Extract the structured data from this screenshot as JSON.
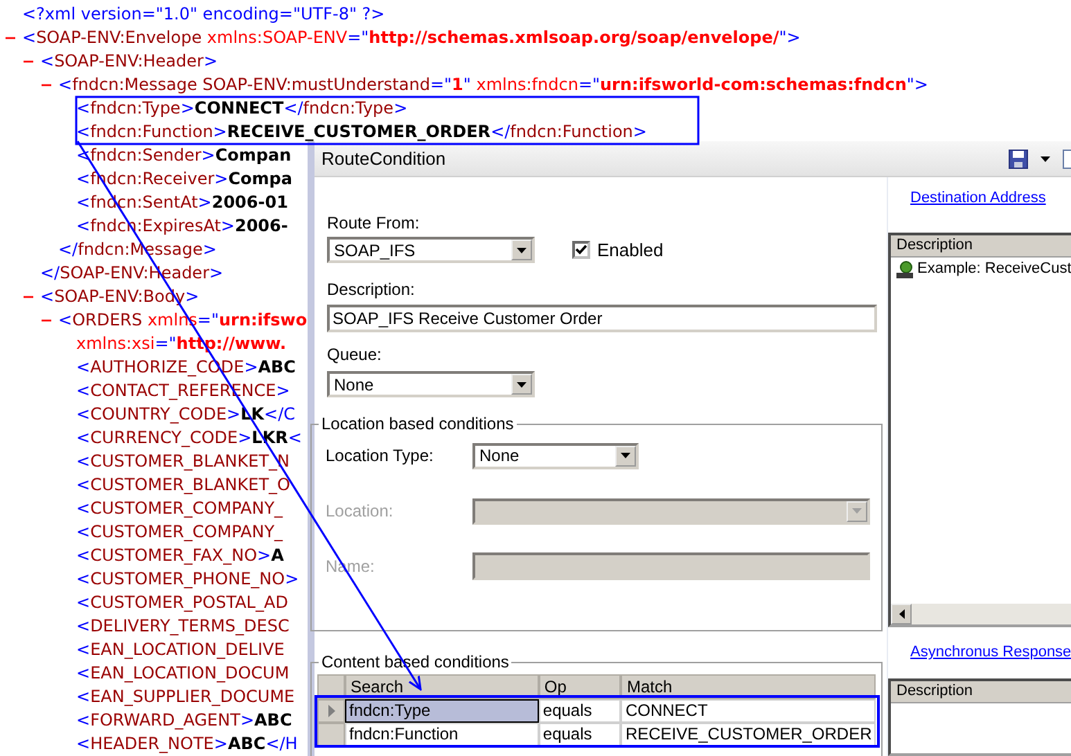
{
  "xml_tree": [
    {
      "parts": [
        {
          "kind": "punct",
          "text": "<?xml version=\"1.0\" encoding=\"UTF-8\" ?>"
        }
      ]
    },
    {
      "expanded": true,
      "parts": [
        {
          "kind": "punct",
          "text": "<"
        },
        {
          "kind": "name",
          "text": "SOAP-ENV:Envelope"
        },
        {
          "kind": "attr",
          "text": " xmlns:SOAP-ENV"
        },
        {
          "kind": "punct",
          "text": "=\""
        },
        {
          "kind": "value",
          "text": "http://schemas.xmlsoap.org/soap/envelope/"
        },
        {
          "kind": "punct",
          "text": "\">"
        }
      ],
      "children": [
        {
          "expanded": true,
          "parts": [
            {
              "kind": "punct",
              "text": "<"
            },
            {
              "kind": "name",
              "text": "SOAP-ENV:Header"
            },
            {
              "kind": "punct",
              "text": ">"
            }
          ],
          "children": [
            {
              "expanded": true,
              "parts": [
                {
                  "kind": "punct",
                  "text": "<"
                },
                {
                  "kind": "name",
                  "text": "fndcn:Message SOAP-ENV:mustUnderstand"
                },
                {
                  "kind": "punct",
                  "text": "=\""
                },
                {
                  "kind": "value",
                  "text": "1"
                },
                {
                  "kind": "punct",
                  "text": "\""
                },
                {
                  "kind": "attr",
                  "text": " xmlns:fndcn"
                },
                {
                  "kind": "punct",
                  "text": "=\""
                },
                {
                  "kind": "value",
                  "text": "urn:ifsworld-com:schemas:fndcn"
                },
                {
                  "kind": "punct",
                  "text": "\">"
                }
              ],
              "children": [
                {
                  "parts": [
                    {
                      "kind": "punct",
                      "text": "<"
                    },
                    {
                      "kind": "name",
                      "text": "fndcn:Type"
                    },
                    {
                      "kind": "punct",
                      "text": ">"
                    },
                    {
                      "kind": "text",
                      "text": "CONNECT"
                    },
                    {
                      "kind": "punct",
                      "text": "</"
                    },
                    {
                      "kind": "name",
                      "text": "fndcn:Type"
                    },
                    {
                      "kind": "punct",
                      "text": ">"
                    }
                  ]
                },
                {
                  "parts": [
                    {
                      "kind": "punct",
                      "text": "<"
                    },
                    {
                      "kind": "name",
                      "text": "fndcn:Function"
                    },
                    {
                      "kind": "punct",
                      "text": ">"
                    },
                    {
                      "kind": "text",
                      "text": "RECEIVE_CUSTOMER_ORDER"
                    },
                    {
                      "kind": "punct",
                      "text": "</"
                    },
                    {
                      "kind": "name",
                      "text": "fndcn:Function"
                    },
                    {
                      "kind": "punct",
                      "text": ">"
                    }
                  ]
                },
                {
                  "parts": [
                    {
                      "kind": "punct",
                      "text": "<"
                    },
                    {
                      "kind": "name",
                      "text": "fndcn:Sender"
                    },
                    {
                      "kind": "punct",
                      "text": ">"
                    },
                    {
                      "kind": "text",
                      "text": "Compan"
                    }
                  ]
                },
                {
                  "parts": [
                    {
                      "kind": "punct",
                      "text": "<"
                    },
                    {
                      "kind": "name",
                      "text": "fndcn:Receiver"
                    },
                    {
                      "kind": "punct",
                      "text": ">"
                    },
                    {
                      "kind": "text",
                      "text": "Compa"
                    }
                  ]
                },
                {
                  "parts": [
                    {
                      "kind": "punct",
                      "text": "<"
                    },
                    {
                      "kind": "name",
                      "text": "fndcn:SentAt"
                    },
                    {
                      "kind": "punct",
                      "text": ">"
                    },
                    {
                      "kind": "text",
                      "text": "2006-01"
                    }
                  ]
                },
                {
                  "parts": [
                    {
                      "kind": "punct",
                      "text": "<"
                    },
                    {
                      "kind": "name",
                      "text": "fndcn:ExpiresAt"
                    },
                    {
                      "kind": "punct",
                      "text": ">"
                    },
                    {
                      "kind": "text",
                      "text": "2006-"
                    }
                  ]
                }
              ],
              "close": [
                {
                  "kind": "punct",
                  "text": "</"
                },
                {
                  "kind": "name",
                  "text": "fndcn:Message"
                },
                {
                  "kind": "punct",
                  "text": ">"
                }
              ]
            }
          ],
          "close": [
            {
              "kind": "punct",
              "text": "</"
            },
            {
              "kind": "name",
              "text": "SOAP-ENV:Header"
            },
            {
              "kind": "punct",
              "text": ">"
            }
          ]
        },
        {
          "expanded": true,
          "parts": [
            {
              "kind": "punct",
              "text": "<"
            },
            {
              "kind": "name",
              "text": "SOAP-ENV:Body"
            },
            {
              "kind": "punct",
              "text": ">"
            }
          ],
          "children": [
            {
              "expanded": true,
              "parts": [
                {
                  "kind": "punct",
                  "text": "<"
                },
                {
                  "kind": "name",
                  "text": "ORDERS"
                },
                {
                  "kind": "attr",
                  "text": " xmlns"
                },
                {
                  "kind": "punct",
                  "text": "=\""
                },
                {
                  "kind": "value",
                  "text": "urn:ifswo"
                }
              ],
              "children": [
                {
                  "parts": [
                    {
                      "kind": "attr",
                      "text": "xmlns:xsi"
                    },
                    {
                      "kind": "punct",
                      "text": "=\""
                    },
                    {
                      "kind": "value",
                      "text": "http://www."
                    }
                  ]
                },
                {
                  "parts": [
                    {
                      "kind": "punct",
                      "text": "<"
                    },
                    {
                      "kind": "name",
                      "text": "AUTHORIZE_CODE"
                    },
                    {
                      "kind": "punct",
                      "text": ">"
                    },
                    {
                      "kind": "text",
                      "text": "ABC"
                    }
                  ]
                },
                {
                  "parts": [
                    {
                      "kind": "punct",
                      "text": "<"
                    },
                    {
                      "kind": "name",
                      "text": "CONTACT_REFERENCE"
                    },
                    {
                      "kind": "punct",
                      "text": ">"
                    }
                  ]
                },
                {
                  "parts": [
                    {
                      "kind": "punct",
                      "text": "<"
                    },
                    {
                      "kind": "name",
                      "text": "COUNTRY_CODE"
                    },
                    {
                      "kind": "punct",
                      "text": ">"
                    },
                    {
                      "kind": "text",
                      "text": "LK"
                    },
                    {
                      "kind": "punct",
                      "text": "</C"
                    }
                  ]
                },
                {
                  "parts": [
                    {
                      "kind": "punct",
                      "text": "<"
                    },
                    {
                      "kind": "name",
                      "text": "CURRENCY_CODE"
                    },
                    {
                      "kind": "punct",
                      "text": ">"
                    },
                    {
                      "kind": "text",
                      "text": "LKR"
                    },
                    {
                      "kind": "punct",
                      "text": "<"
                    }
                  ]
                },
                {
                  "parts": [
                    {
                      "kind": "punct",
                      "text": "<"
                    },
                    {
                      "kind": "name",
                      "text": "CUSTOMER_BLANKET_N"
                    }
                  ]
                },
                {
                  "parts": [
                    {
                      "kind": "punct",
                      "text": "<"
                    },
                    {
                      "kind": "name",
                      "text": "CUSTOMER_BLANKET_O"
                    }
                  ]
                },
                {
                  "parts": [
                    {
                      "kind": "punct",
                      "text": "<"
                    },
                    {
                      "kind": "name",
                      "text": "CUSTOMER_COMPANY_"
                    }
                  ]
                },
                {
                  "parts": [
                    {
                      "kind": "punct",
                      "text": "<"
                    },
                    {
                      "kind": "name",
                      "text": "CUSTOMER_COMPANY_"
                    }
                  ]
                },
                {
                  "parts": [
                    {
                      "kind": "punct",
                      "text": "<"
                    },
                    {
                      "kind": "name",
                      "text": "CUSTOMER_FAX_NO"
                    },
                    {
                      "kind": "punct",
                      "text": ">"
                    },
                    {
                      "kind": "text",
                      "text": "A"
                    }
                  ]
                },
                {
                  "parts": [
                    {
                      "kind": "punct",
                      "text": "<"
                    },
                    {
                      "kind": "name",
                      "text": "CUSTOMER_PHONE_NO"
                    },
                    {
                      "kind": "punct",
                      "text": ">"
                    }
                  ]
                },
                {
                  "parts": [
                    {
                      "kind": "punct",
                      "text": "<"
                    },
                    {
                      "kind": "name",
                      "text": "CUSTOMER_POSTAL_AD"
                    }
                  ]
                },
                {
                  "parts": [
                    {
                      "kind": "punct",
                      "text": "<"
                    },
                    {
                      "kind": "name",
                      "text": "DELIVERY_TERMS_DESC"
                    }
                  ]
                },
                {
                  "parts": [
                    {
                      "kind": "punct",
                      "text": "<"
                    },
                    {
                      "kind": "name",
                      "text": "EAN_LOCATION_DELIVE"
                    }
                  ]
                },
                {
                  "parts": [
                    {
                      "kind": "punct",
                      "text": "<"
                    },
                    {
                      "kind": "name",
                      "text": "EAN_LOCATION_DOCUM"
                    }
                  ]
                },
                {
                  "parts": [
                    {
                      "kind": "punct",
                      "text": "<"
                    },
                    {
                      "kind": "name",
                      "text": "EAN_SUPPLIER_DOCUME"
                    }
                  ]
                },
                {
                  "parts": [
                    {
                      "kind": "punct",
                      "text": "<"
                    },
                    {
                      "kind": "name",
                      "text": "FORWARD_AGENT"
                    },
                    {
                      "kind": "punct",
                      "text": ">"
                    },
                    {
                      "kind": "text",
                      "text": "ABC"
                    }
                  ]
                },
                {
                  "parts": [
                    {
                      "kind": "punct",
                      "text": "<"
                    },
                    {
                      "kind": "name",
                      "text": "HEADER_NOTE"
                    },
                    {
                      "kind": "punct",
                      "text": ">"
                    },
                    {
                      "kind": "text",
                      "text": "ABC"
                    },
                    {
                      "kind": "punct",
                      "text": "</H"
                    }
                  ]
                }
              ]
            }
          ]
        }
      ]
    }
  ],
  "window": {
    "title": "RouteCondition",
    "route_from": {
      "label": "Route From:",
      "value": "SOAP_IFS"
    },
    "enabled": {
      "label": "Enabled",
      "checked": true
    },
    "description": {
      "label": "Description:",
      "value": "SOAP_IFS Receive Customer Order"
    },
    "queue": {
      "label": "Queue:",
      "value": "None"
    },
    "location_group": {
      "title": "Location based conditions",
      "fields": [
        {
          "kind": "select",
          "label": "Location Type:",
          "value": "None",
          "disabled": false
        },
        {
          "kind": "select",
          "label": "Location:",
          "disabled": true
        },
        {
          "kind": "text",
          "label": "Name:",
          "disabled": true
        }
      ]
    },
    "content_group": {
      "title": "Content based conditions",
      "columns": [
        "Search",
        "Op",
        "Match"
      ],
      "rows": [
        {
          "selected": true,
          "cells": [
            "fndcn:Type",
            "equals",
            "CONNECT"
          ]
        },
        {
          "selected": false,
          "cells": [
            "fndcn:Function",
            "equals",
            "RECEIVE_CUSTOMER_ORDER"
          ]
        }
      ]
    },
    "right_pane": {
      "destination_link": "Destination Address",
      "destination_list": {
        "header": "Description",
        "items": [
          "Example: ReceiveCust"
        ]
      },
      "async_link": "Asynchronus Response",
      "async_list": {
        "header": "Description"
      }
    }
  }
}
